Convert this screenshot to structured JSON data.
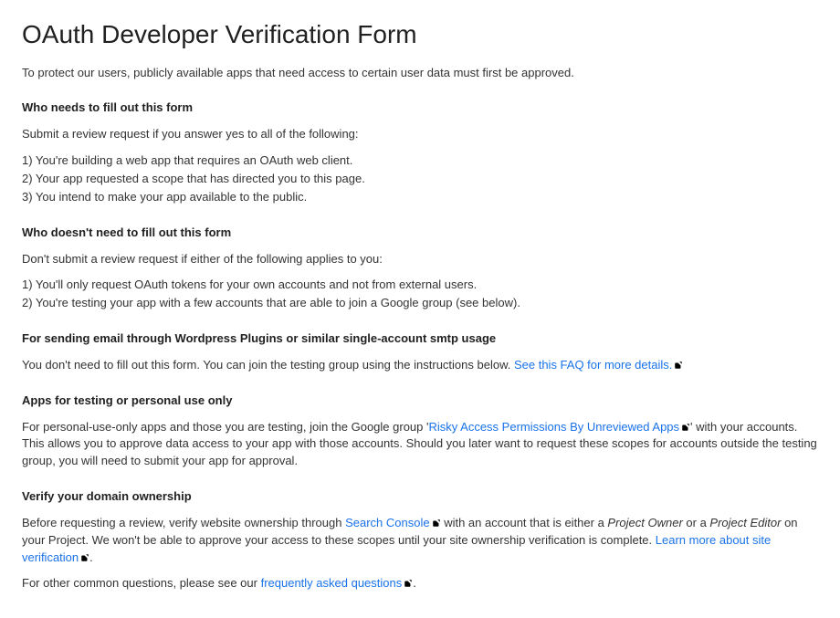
{
  "title": "OAuth Developer Verification Form",
  "intro": "To protect our users, publicly available apps that need access to certain user data must first be approved.",
  "who_needs": {
    "heading": "Who needs to fill out this form",
    "lead": "Submit a review request if you answer yes to all of the following:",
    "items": [
      "1) You're building a web app that requires an OAuth web client.",
      "2) Your app requested a scope that has directed you to this page.",
      "3) You intend to make your app available to the public."
    ]
  },
  "who_not": {
    "heading": "Who doesn't need to fill out this form",
    "lead": "Don't submit a review request if either of the following applies to you:",
    "items": [
      "1) You'll only request OAuth tokens for your own accounts and not from external users.",
      "2) You're testing your app with a few accounts that are able to join a Google group (see below)."
    ]
  },
  "smtp": {
    "heading": "For sending email through Wordpress Plugins or similar single-account smtp usage",
    "text": "You don't need to fill out this form. You can join the testing group using the instructions below. ",
    "link": "See this FAQ for more details."
  },
  "testing": {
    "heading": "Apps for testing or personal use only",
    "pre": "For personal-use-only apps and those you are testing, join the Google group '",
    "link": "Risky Access Permissions By Unreviewed Apps",
    "post": "' with your accounts. This allows you to approve data access to your app with those accounts. Should you later want to request these scopes for accounts outside the testing group, you will need to submit your app for approval."
  },
  "verify": {
    "heading": "Verify your domain ownership",
    "pre": "Before requesting a review, verify website ownership through ",
    "link_search": "Search Console",
    "mid1": " with an account that is either a ",
    "em_owner": "Project Owner",
    "mid2": " or a ",
    "em_editor": "Project Editor",
    "mid3": " on your Project. We won't be able to approve your access to these scopes until your site ownership verification is complete. ",
    "link_learn": "Learn more about site verification",
    "period": "."
  },
  "faq": {
    "pre": "For other common questions, please see our ",
    "link": "frequently asked questions",
    "period": "."
  }
}
